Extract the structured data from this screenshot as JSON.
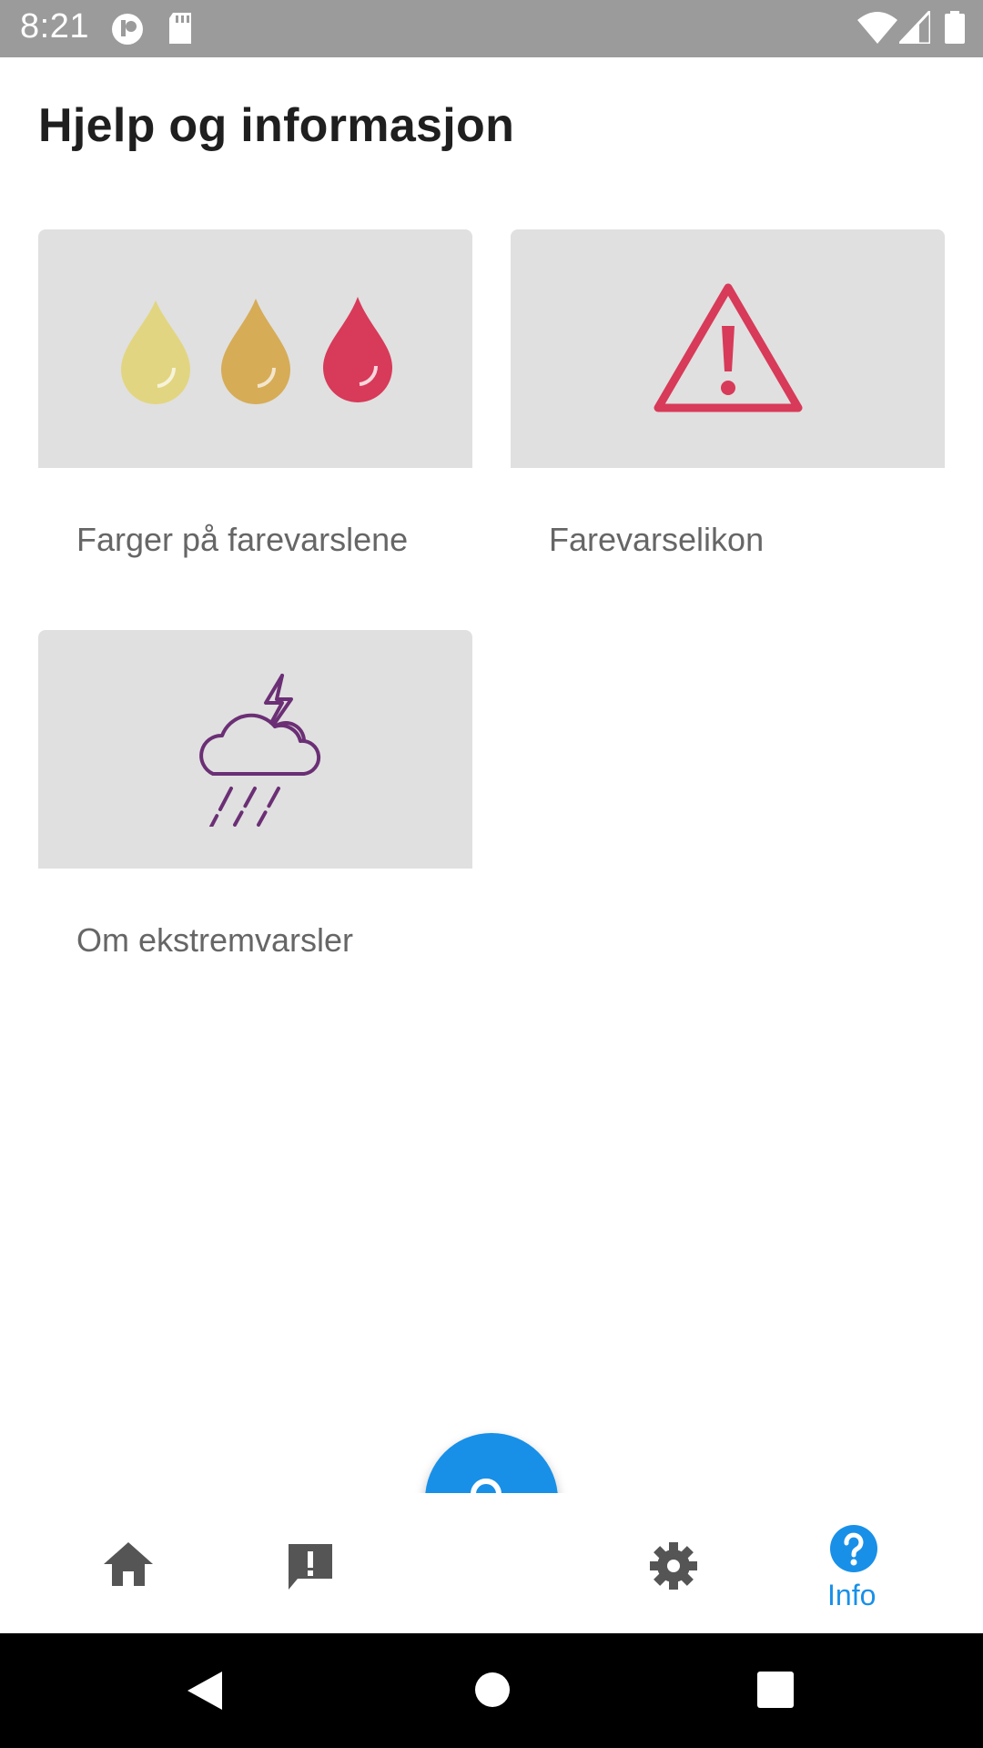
{
  "status_bar": {
    "time": "8:21",
    "left_icons": [
      "notification-app-icon",
      "sd-card-icon"
    ],
    "right_icons": [
      "wifi-icon",
      "cellular-signal-icon",
      "battery-icon"
    ]
  },
  "page": {
    "title": "Hjelp og informasjon"
  },
  "cards": [
    {
      "label": "Farger på farevarslene",
      "icon": "three-color-drops-icon",
      "colors": [
        "#e2d581",
        "#d6ac57",
        "#d83a59"
      ]
    },
    {
      "label": "Farevarselikon",
      "icon": "warning-triangle-icon",
      "colors": [
        "#d83a59"
      ]
    },
    {
      "label": "Om ekstremvarsler",
      "icon": "thunderstorm-rain-icon",
      "colors": [
        "#6b2f75"
      ]
    }
  ],
  "bottom_nav": {
    "items": [
      {
        "icon": "home-icon"
      },
      {
        "icon": "alert-message-icon"
      },
      {
        "icon": "gear-icon"
      },
      {
        "icon": "help-icon",
        "label": "Info",
        "active": true
      }
    ],
    "fab_icon": "search-icon",
    "accent": "#1890e8",
    "inactive": "#555555"
  },
  "system_nav": [
    "back-icon",
    "home-circle-icon",
    "recents-icon"
  ]
}
